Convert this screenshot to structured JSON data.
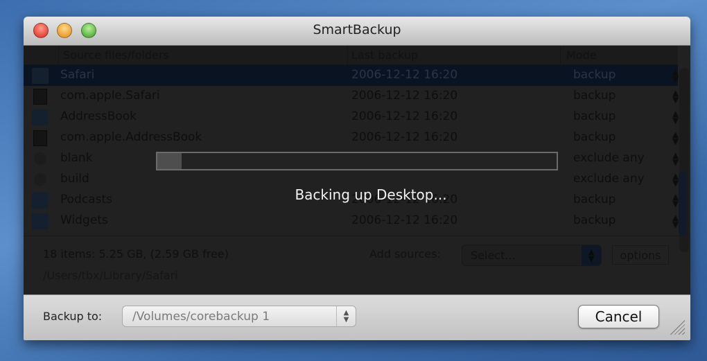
{
  "window": {
    "title": "SmartBackup"
  },
  "table": {
    "columns": [
      "Source files/folders",
      "Last backup",
      "Mode"
    ],
    "rows": [
      {
        "icon": "folder",
        "name": "Safari",
        "last": "2006-12-12 16:20",
        "mode": "backup",
        "selected": true
      },
      {
        "icon": "file",
        "name": "com.apple.Safari",
        "last": "2006-12-12 16:20",
        "mode": "backup"
      },
      {
        "icon": "folder",
        "name": "AddressBook",
        "last": "2006-12-12 16:20",
        "mode": "backup"
      },
      {
        "icon": "file",
        "name": "com.apple.AddressBook",
        "last": "2006-12-12 16:20",
        "mode": "backup"
      },
      {
        "icon": "minus",
        "name": "blank",
        "last": "",
        "mode": "exclude any"
      },
      {
        "icon": "minus",
        "name": "build",
        "last": "",
        "mode": "exclude any"
      },
      {
        "icon": "folder",
        "name": "Podcasts",
        "last": "2006-12-12 16:20",
        "mode": "backup"
      },
      {
        "icon": "folder",
        "name": "Widgets",
        "last": "2006-12-12 16:20",
        "mode": "backup"
      }
    ]
  },
  "progress": {
    "fraction": 0.06,
    "message": "Backing up Desktop..."
  },
  "footer": {
    "summary": "18 items: 5.25 GB, (2.59 GB free)",
    "path": "/Users/tbx/Library/Safari",
    "add_sources_label": "Add sources:",
    "add_sources_value": "Select...",
    "options_label": "options"
  },
  "bottom": {
    "backup_to_label": "Backup to:",
    "backup_to_value": "/Volumes/corebackup 1",
    "cancel_label": "Cancel"
  }
}
